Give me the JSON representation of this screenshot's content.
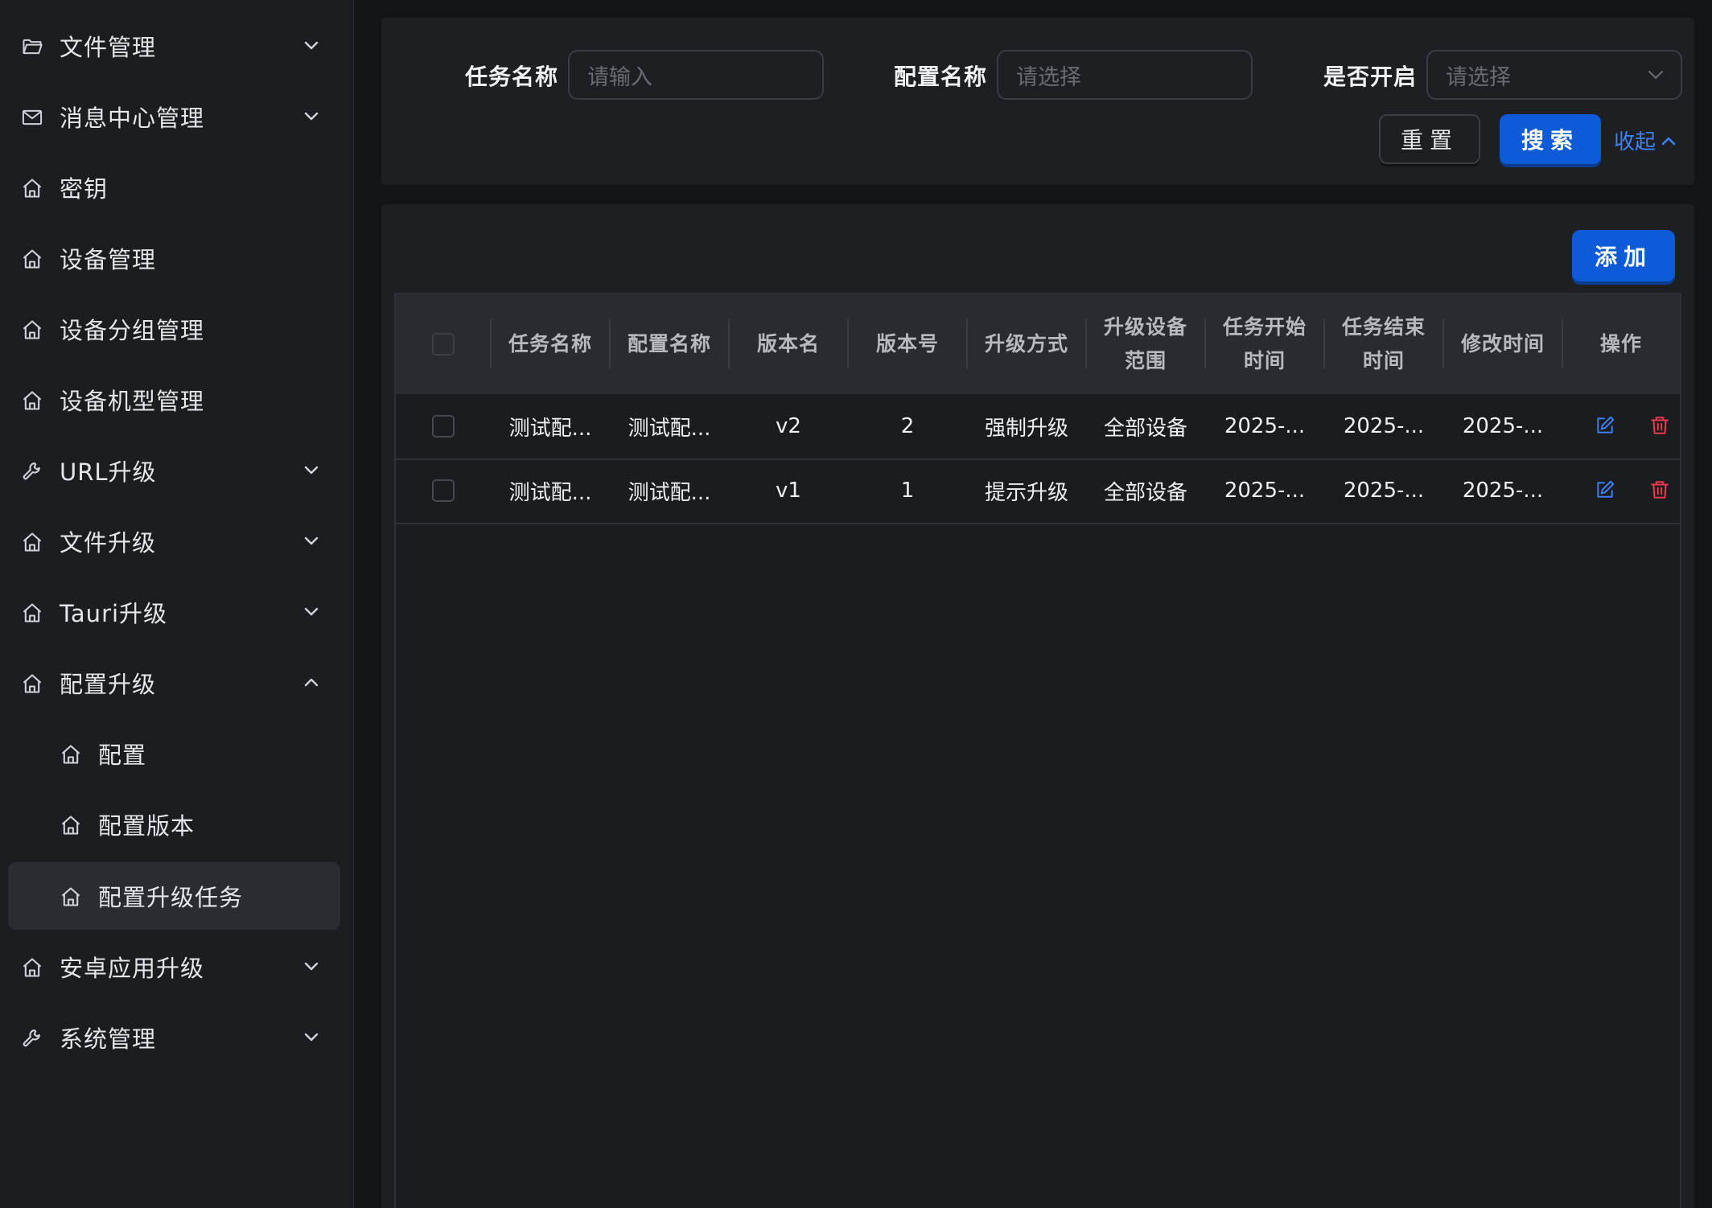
{
  "sidebar": {
    "items": [
      {
        "label": "文件管理",
        "icon": "folder-icon",
        "chevron": "down"
      },
      {
        "label": "消息中心管理",
        "icon": "mail-icon",
        "chevron": "down"
      },
      {
        "label": "密钥",
        "icon": "home-icon",
        "chevron": ""
      },
      {
        "label": "设备管理",
        "icon": "home-icon",
        "chevron": ""
      },
      {
        "label": "设备分组管理",
        "icon": "home-icon",
        "chevron": ""
      },
      {
        "label": "设备机型管理",
        "icon": "home-icon",
        "chevron": ""
      },
      {
        "label": "URL升级",
        "icon": "wrench-icon",
        "chevron": "down"
      },
      {
        "label": "文件升级",
        "icon": "home-icon",
        "chevron": "down"
      },
      {
        "label": "Tauri升级",
        "icon": "home-icon",
        "chevron": "down"
      },
      {
        "label": "配置升级",
        "icon": "home-icon",
        "chevron": "up",
        "expanded": true
      },
      {
        "label": "配置",
        "icon": "home-icon",
        "sub": true
      },
      {
        "label": "配置版本",
        "icon": "home-icon",
        "sub": true
      },
      {
        "label": "配置升级任务",
        "icon": "home-icon",
        "sub": true,
        "active": true
      },
      {
        "label": "安卓应用升级",
        "icon": "home-icon",
        "chevron": "down"
      },
      {
        "label": "系统管理",
        "icon": "wrench-icon",
        "chevron": "down"
      }
    ]
  },
  "filters": {
    "task_name_label": "任务名称",
    "task_name_placeholder": "请输入",
    "config_name_label": "配置名称",
    "config_name_placeholder": "请选择",
    "enabled_label": "是否开启",
    "enabled_placeholder": "请选择",
    "reset_label": "重置",
    "search_label": "搜索",
    "collapse_label": "收起"
  },
  "toolbar": {
    "add_label": "添加"
  },
  "table": {
    "headers": [
      "任务名称",
      "配置名称",
      "版本名",
      "版本号",
      "升级方式",
      "升级设备范围",
      "任务开始时间",
      "任务结束时间",
      "修改时间",
      "操作"
    ],
    "header_lines": {
      "device_scope": [
        "升级设备",
        "范围"
      ],
      "start_time": [
        "任务开始",
        "时间"
      ],
      "end_time": [
        "任务结束",
        "时间"
      ]
    },
    "rows": [
      {
        "task_name": "测试配...",
        "config_name": "测试配...",
        "version_name": "v2",
        "version_no": "2",
        "upgrade_mode": "强制升级",
        "device_scope": "全部设备",
        "start_time": "2025-...",
        "end_time": "2025-...",
        "modified_time": "2025-..."
      },
      {
        "task_name": "测试配...",
        "config_name": "测试配...",
        "version_name": "v1",
        "version_no": "1",
        "upgrade_mode": "提示升级",
        "device_scope": "全部设备",
        "start_time": "2025-...",
        "end_time": "2025-...",
        "modified_time": "2025-..."
      }
    ]
  },
  "colors": {
    "primary": "#0d5bd6",
    "link": "#3b82f6",
    "edit": "#3b82f6",
    "delete": "#f0384f",
    "background": "#141518",
    "panel": "#1e1f23"
  }
}
